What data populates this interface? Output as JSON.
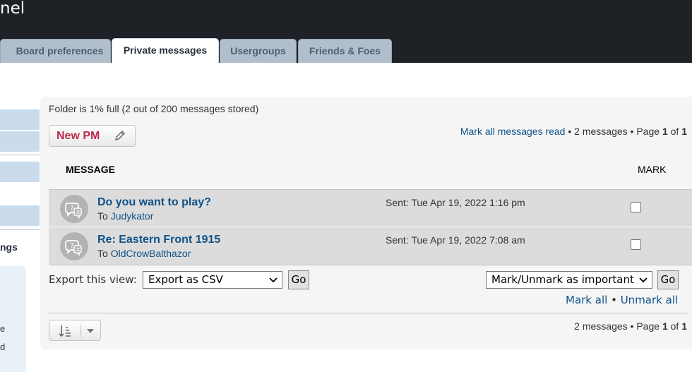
{
  "header": {
    "title_fragment": "nel"
  },
  "tabs": [
    {
      "label": "Board preferences",
      "active": false
    },
    {
      "label": "Private messages",
      "active": true
    },
    {
      "label": "Usergroups",
      "active": false
    },
    {
      "label": "Friends & Foes",
      "active": false
    }
  ],
  "sidenav": {
    "visible_label_fragment": "ngs",
    "panel_fragments": [
      "e",
      "d"
    ]
  },
  "folder": {
    "info": "Folder is 1% full (2 out of 200 messages stored)"
  },
  "toolbar": {
    "new_pm_label": "New PM",
    "pencil_icon": "pencil-icon"
  },
  "pagination_top": {
    "mark_read_link": "Mark all messages read",
    "sep1": " • ",
    "count": "2 messages",
    "sep2": " • Page ",
    "current": "1",
    "of": " of ",
    "total": "1"
  },
  "table": {
    "columns": [
      "MESSAGE",
      "MARK"
    ],
    "rows": [
      {
        "title": "Do you want to play?",
        "to_prefix": "To ",
        "to_user": "Judykator",
        "sent": "Sent: Tue Apr 19, 2022 1:16 pm",
        "marked": false
      },
      {
        "title": "Re: Eastern Front 1915",
        "to_prefix": "To ",
        "to_user": "OldCrowBalthazor",
        "sent": "Sent: Tue Apr 19, 2022 7:08 am",
        "marked": false
      }
    ]
  },
  "export": {
    "label": "Export this view:",
    "selected": "Export as CSV",
    "go_label": "Go"
  },
  "mark_action": {
    "selected": "Mark/Unmark as important",
    "go_label": "Go",
    "mark_all": "Mark all",
    "separator": " • ",
    "unmark_all": "Unmark all"
  },
  "pagination_bottom": {
    "count": "2 messages",
    "sep": " • Page ",
    "current": "1",
    "of": " of ",
    "total": "1"
  },
  "colors": {
    "header_bg": "#1e2126",
    "tab_bg": "#b1bfcd",
    "link": "#105289",
    "new_pm": "#bc2a4d",
    "row_bg": "#dcdcdc",
    "panel_bg": "#f5f5f5"
  }
}
